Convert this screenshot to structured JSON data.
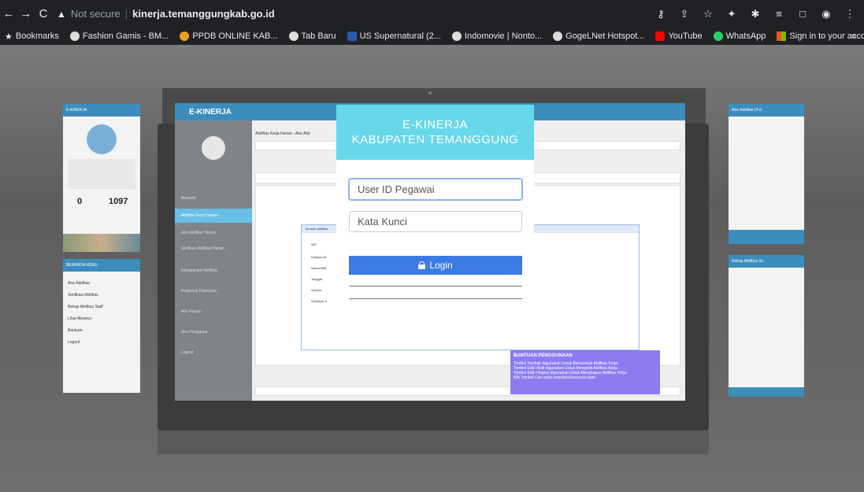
{
  "browser": {
    "not_secure": "Not secure",
    "separator": "|",
    "url": "kinerja.temanggungkab.go.id",
    "bookmarks": [
      {
        "label": "Bookmarks",
        "icon": "star-icon"
      },
      {
        "label": "Fashion Gamis - BM...",
        "icon": "globe-icon"
      },
      {
        "label": "PPDB ONLINE KAB...",
        "icon": "ppdb-icon"
      },
      {
        "label": "Tab Baru",
        "icon": "globe-icon"
      },
      {
        "label": "US Supernatural (2...",
        "icon": "dfl-icon"
      },
      {
        "label": "Indomovie | Nonto...",
        "icon": "globe-icon"
      },
      {
        "label": "GogeLNet Hotspot...",
        "icon": "globe-icon"
      },
      {
        "label": "YouTube",
        "icon": "youtube-icon"
      },
      {
        "label": "WhatsApp",
        "icon": "whatsapp-icon"
      },
      {
        "label": "Sign in to your acco...",
        "icon": "microsoft-icon"
      }
    ],
    "more": "»"
  },
  "login": {
    "title_line1": "E-KINERJA",
    "title_line2": "KABUPATEN TEMANGGUNG",
    "user_placeholder": "User ID Pegawai",
    "password_placeholder": "Kata Kunci",
    "login_label": "Login"
  },
  "app": {
    "header": "E-KINERJA",
    "breadcrumb": "Aktifitas Kerja Harian › Atur Akti",
    "side": [
      "Beranda",
      "Aktifitas Kerja Harian",
      "Atur Aktifitas Harian",
      "Verifikasi Aktifitas Harian",
      "Rekapitulasi Aktifitas",
      "Referensi Pekerjaan",
      "Atur Atasan",
      "Atur Pengguna",
      "Logout"
    ],
    "modal_title": "Tambah Aktifitas",
    "fields": [
      "NIP",
      "Kategori Al",
      "Nama Aktif",
      "Tanggal",
      "Volume",
      "Deskripsi A"
    ],
    "help_title": "BANTUAN PENGGUNAAN",
    "help_lines": [
      "Tombol Tambah digunakan Untuk Menambah Aktifitas Kerja",
      "Tombol Edit->Edit digunakan Untuk Mengedit Aktifitas Kerja",
      "Tombol Edit->Hapus digunakan Untuk Menghapus Aktifitas Kerja",
      "Klik Tombol Cari untuk merefresh/mencari data"
    ]
  },
  "left_phone": {
    "header": "E-KINERJA",
    "stat1": "0",
    "stat2": "1097"
  },
  "left_menu": {
    "header": "BERANDA MENU",
    "items": [
      "Atur Aktifitas",
      "Verifikasi Aktifitas",
      "Rekap Aktifitas Staff",
      "Lihat Absensi",
      "Bantuan",
      "Logout"
    ]
  },
  "right_phone1": {
    "header": "Atur Aktifitas (4 d"
  },
  "right_phone2": {
    "header": "Rekap Aktifitas St..."
  }
}
